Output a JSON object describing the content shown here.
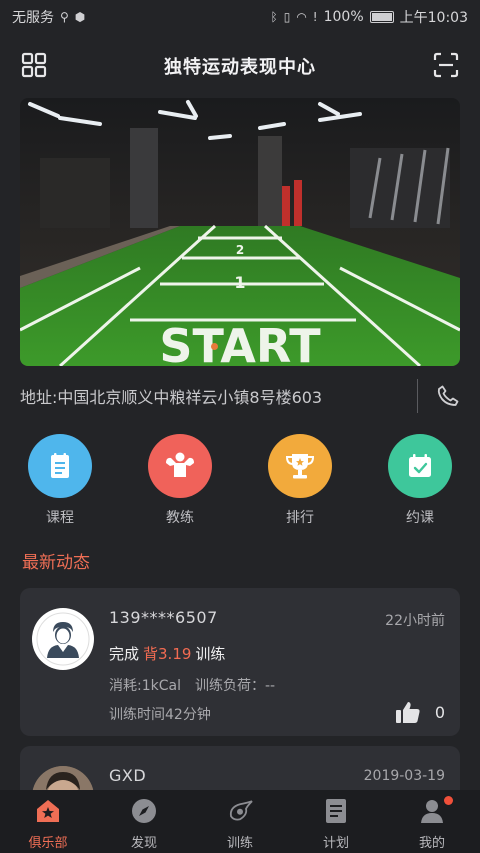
{
  "status_bar": {
    "carrier": "无服务",
    "battery": "100%",
    "time": "上午10:03"
  },
  "header": {
    "title": "独特运动表现中心",
    "left_icon": "grid-icon",
    "right_icon": "scan-icon"
  },
  "banner": {
    "image_text": "START"
  },
  "address": {
    "text": "地址:中国北京顺义中粮祥云小镇8号楼603",
    "icon": "phone-icon"
  },
  "quick_actions": [
    {
      "label": "课程",
      "icon": "notepad-icon",
      "color": "#4fb6ec"
    },
    {
      "label": "教练",
      "icon": "muscle-icon",
      "color": "#f0625a"
    },
    {
      "label": "排行",
      "icon": "trophy-icon",
      "color": "#f2aa3c"
    },
    {
      "label": "约课",
      "icon": "calendar-check-icon",
      "color": "#3ec79b"
    }
  ],
  "section": {
    "title": "最新动态"
  },
  "feed": [
    {
      "user": "139****6507",
      "time": "22小时前",
      "action_prefix": "完成",
      "action_highlight": "背3.19",
      "action_suffix": "训练",
      "calories": "消耗:1kCal",
      "load": "训练负荷：--",
      "duration": "训练时间42分钟",
      "likes": "0"
    },
    {
      "user": "GXD",
      "time": "2019-03-19"
    }
  ],
  "tabs": [
    {
      "label": "俱乐部",
      "icon": "club-icon",
      "active": true
    },
    {
      "label": "发现",
      "icon": "compass-icon",
      "active": false
    },
    {
      "label": "训练",
      "icon": "training-icon",
      "active": false
    },
    {
      "label": "计划",
      "icon": "plan-icon",
      "active": false
    },
    {
      "label": "我的",
      "icon": "profile-icon",
      "active": false
    }
  ],
  "colors": {
    "accent": "#ee6e55",
    "background": "#232427",
    "card": "#2f3035"
  }
}
